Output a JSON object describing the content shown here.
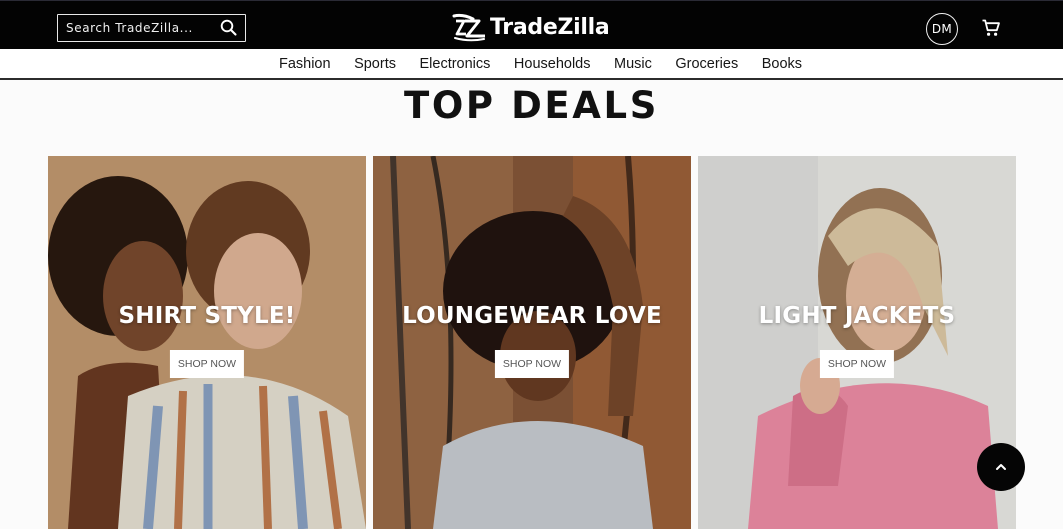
{
  "header": {
    "search_placeholder": "Search TradeZilla...",
    "search_icon": "search-icon",
    "logo_text": "TradeZilla",
    "logo_icon": "tz-logo-mark",
    "avatar_initials": "DM",
    "cart_icon": "cart-icon"
  },
  "nav": {
    "items": [
      "Fashion",
      "Sports",
      "Electronics",
      "Households",
      "Music",
      "Groceries",
      "Books"
    ]
  },
  "main": {
    "heading": "TOP DEALS",
    "cards": [
      {
        "title": "SHIRT STYLE!",
        "button": "SHOP NOW"
      },
      {
        "title": "LOUNGEWEAR LOVE",
        "button": "SHOP NOW"
      },
      {
        "title": "LIGHT JACKETS",
        "button": "SHOP NOW"
      }
    ]
  },
  "scroll_top_icon": "chevron-up-icon",
  "colors": {
    "topbar": "#030303",
    "page_bg": "#fbfbfb",
    "heading": "#111111"
  }
}
